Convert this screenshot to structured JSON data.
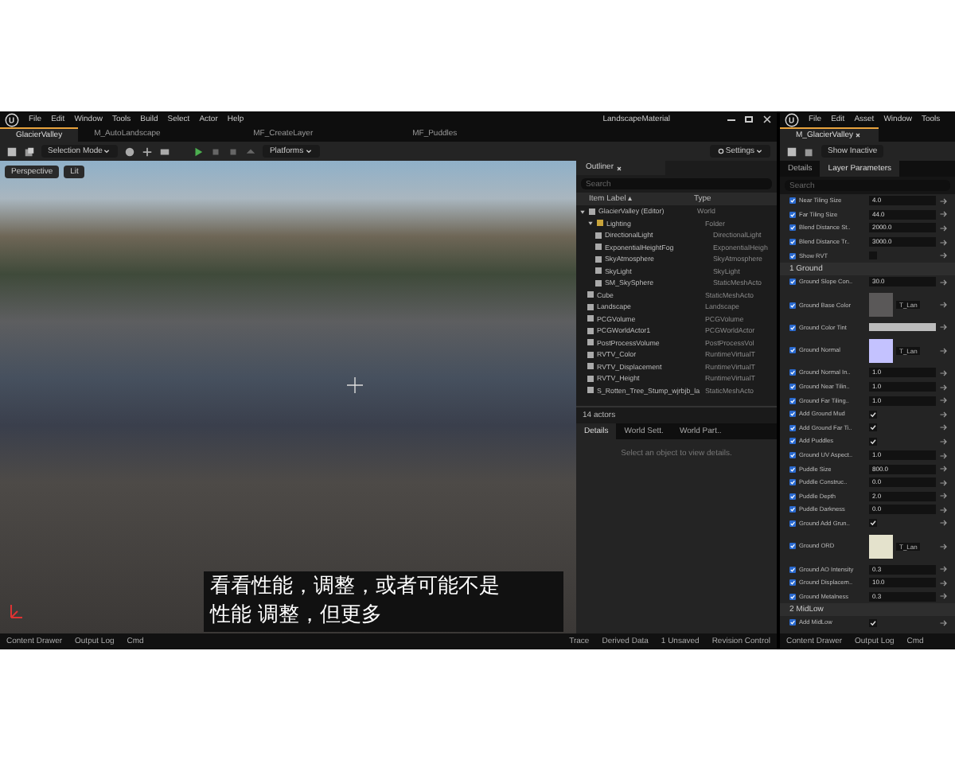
{
  "main_window": {
    "title": "LandscapeMaterial",
    "menu": [
      "File",
      "Edit",
      "Window",
      "Tools",
      "Build",
      "Select",
      "Actor",
      "Help"
    ],
    "tabs": [
      {
        "label": "GlacierValley",
        "selected": true
      },
      {
        "label": "M_AutoLandscape",
        "selected": false
      },
      {
        "label": "MF_CreateLayer",
        "selected": false
      },
      {
        "label": "MF_Puddles",
        "selected": false
      }
    ],
    "toolbar": {
      "mode": "Selection Mode",
      "platforms": "Platforms",
      "settings": "Settings"
    },
    "viewport": {
      "buttons": [
        "Perspective",
        "Lit"
      ]
    },
    "subtitle": [
      "看看性能，调整，或者可能不是",
      "性能  调整，但更多"
    ],
    "outliner": {
      "tab": "Outliner",
      "search_placeholder": "Search",
      "columns": [
        "Item Label ▴",
        "Type"
      ],
      "rows": [
        {
          "label": "GlacierValley (Editor)",
          "type": "World",
          "expanded": true,
          "children": [
            {
              "label": "Lighting",
              "type": "Folder",
              "expanded": true,
              "children": [
                {
                  "label": "DirectionalLight",
                  "type": "DirectionalLight"
                },
                {
                  "label": "ExponentialHeightFog",
                  "type": "ExponentialHeigh"
                },
                {
                  "label": "SkyAtmosphere",
                  "type": "SkyAtmosphere"
                },
                {
                  "label": "SkyLight",
                  "type": "SkyLight"
                },
                {
                  "label": "SM_SkySphere",
                  "type": "StaticMeshActo"
                }
              ]
            },
            {
              "label": "Cube",
              "type": "StaticMeshActo"
            },
            {
              "label": "Landscape",
              "type": "Landscape"
            },
            {
              "label": "PCGVolume",
              "type": "PCGVolume"
            },
            {
              "label": "PCGWorldActor1",
              "type": "PCGWorldActor"
            },
            {
              "label": "PostProcessVolume",
              "type": "PostProcessVol"
            },
            {
              "label": "RVTV_Color",
              "type": "RuntimeVirtualT"
            },
            {
              "label": "RVTV_Displacement",
              "type": "RuntimeVirtualT"
            },
            {
              "label": "RVTV_Height",
              "type": "RuntimeVirtualT"
            },
            {
              "label": "S_Rotten_Tree_Stump_wjrbjb_la",
              "type": "StaticMeshActo"
            }
          ]
        }
      ],
      "count": "14 actors"
    },
    "details": {
      "tabs": [
        {
          "label": "Details",
          "selected": true
        },
        {
          "label": "World Sett.",
          "selected": false
        },
        {
          "label": "World Part..",
          "selected": false
        }
      ],
      "empty_message": "Select an object to view details."
    },
    "status_bar": {
      "items": [
        "Content Drawer",
        "Output Log",
        "Cmd"
      ],
      "right": [
        "Trace",
        "Derived Data",
        "1 Unsaved",
        "Revision Control"
      ]
    }
  },
  "material_window": {
    "menu": [
      "File",
      "Edit",
      "Asset",
      "Window",
      "Tools"
    ],
    "tab": "M_GlacierValley",
    "show_inactive": "Show Inactive",
    "tabs": [
      {
        "label": "Details",
        "selected": false
      },
      {
        "label": "Layer Parameters",
        "selected": true
      }
    ],
    "search_placeholder": "Search",
    "params": [
      {
        "kind": "value",
        "label": "Near Tiling Size",
        "value": "4.0",
        "overridden": true
      },
      {
        "kind": "value",
        "label": "Far Tiling Size",
        "value": "44.0",
        "overridden": true
      },
      {
        "kind": "value",
        "label": "Blend Distance St..",
        "value": "2000.0",
        "overridden": true
      },
      {
        "kind": "value",
        "label": "Blend Distance Tr..",
        "value": "3000.0",
        "overridden": true
      },
      {
        "kind": "check",
        "label": "Show RVT",
        "checked": false,
        "overridden": true
      },
      {
        "kind": "group",
        "label": "1 Ground"
      },
      {
        "kind": "value",
        "label": "Ground Slope Con..",
        "value": "30.0",
        "overridden": true
      },
      {
        "kind": "texture",
        "label": "Ground Base Color",
        "asset": "T_Lan",
        "color": "#5a5858",
        "overridden": true
      },
      {
        "kind": "color",
        "label": "Ground Color Tint",
        "color": "#bcbcbc",
        "overridden": true
      },
      {
        "kind": "texture",
        "label": "Ground Normal",
        "asset": "T_Lan",
        "color": "#c4c2ff",
        "overridden": true
      },
      {
        "kind": "value",
        "label": "Ground Normal In..",
        "value": "1.0",
        "overridden": true
      },
      {
        "kind": "value",
        "label": "Ground Near Tilin..",
        "value": "1.0",
        "overridden": true
      },
      {
        "kind": "value",
        "label": "Ground Far Tiling..",
        "value": "1.0",
        "overridden": true
      },
      {
        "kind": "check",
        "label": "Add Ground Mud",
        "checked": true,
        "overridden": true
      },
      {
        "kind": "check",
        "label": "Add Ground Far Ti..",
        "checked": true,
        "overridden": true
      },
      {
        "kind": "check",
        "label": "Add Puddles",
        "checked": true,
        "overridden": true
      },
      {
        "kind": "value",
        "label": "Ground UV Aspect..",
        "value": "1.0",
        "overridden": true
      },
      {
        "kind": "value",
        "label": "Puddle Size",
        "value": "800.0",
        "overridden": true
      },
      {
        "kind": "value",
        "label": "Puddle Construc..",
        "value": "0.0",
        "overridden": true
      },
      {
        "kind": "value",
        "label": "Puddle Depth",
        "value": "2.0",
        "overridden": true
      },
      {
        "kind": "value",
        "label": "Puddle Darkness",
        "value": "0.0",
        "overridden": true
      },
      {
        "kind": "check",
        "label": "Ground Add Grun..",
        "checked": true,
        "overridden": true
      },
      {
        "kind": "texture",
        "label": "Ground ORD",
        "asset": "T_Lan",
        "color": "#e4e2cc",
        "overridden": true
      },
      {
        "kind": "value",
        "label": "Ground AO Intensity",
        "value": "0.3",
        "overridden": true
      },
      {
        "kind": "value",
        "label": "Ground Displacem..",
        "value": "10.0",
        "overridden": true
      },
      {
        "kind": "value",
        "label": "Ground Metalness",
        "value": "0.3",
        "overridden": true
      },
      {
        "kind": "group",
        "label": "2 MidLow"
      },
      {
        "kind": "check",
        "label": "Add MidLow",
        "checked": true,
        "overridden": true
      }
    ],
    "status_bar": [
      "Content Drawer",
      "Output Log",
      "Cmd"
    ]
  }
}
